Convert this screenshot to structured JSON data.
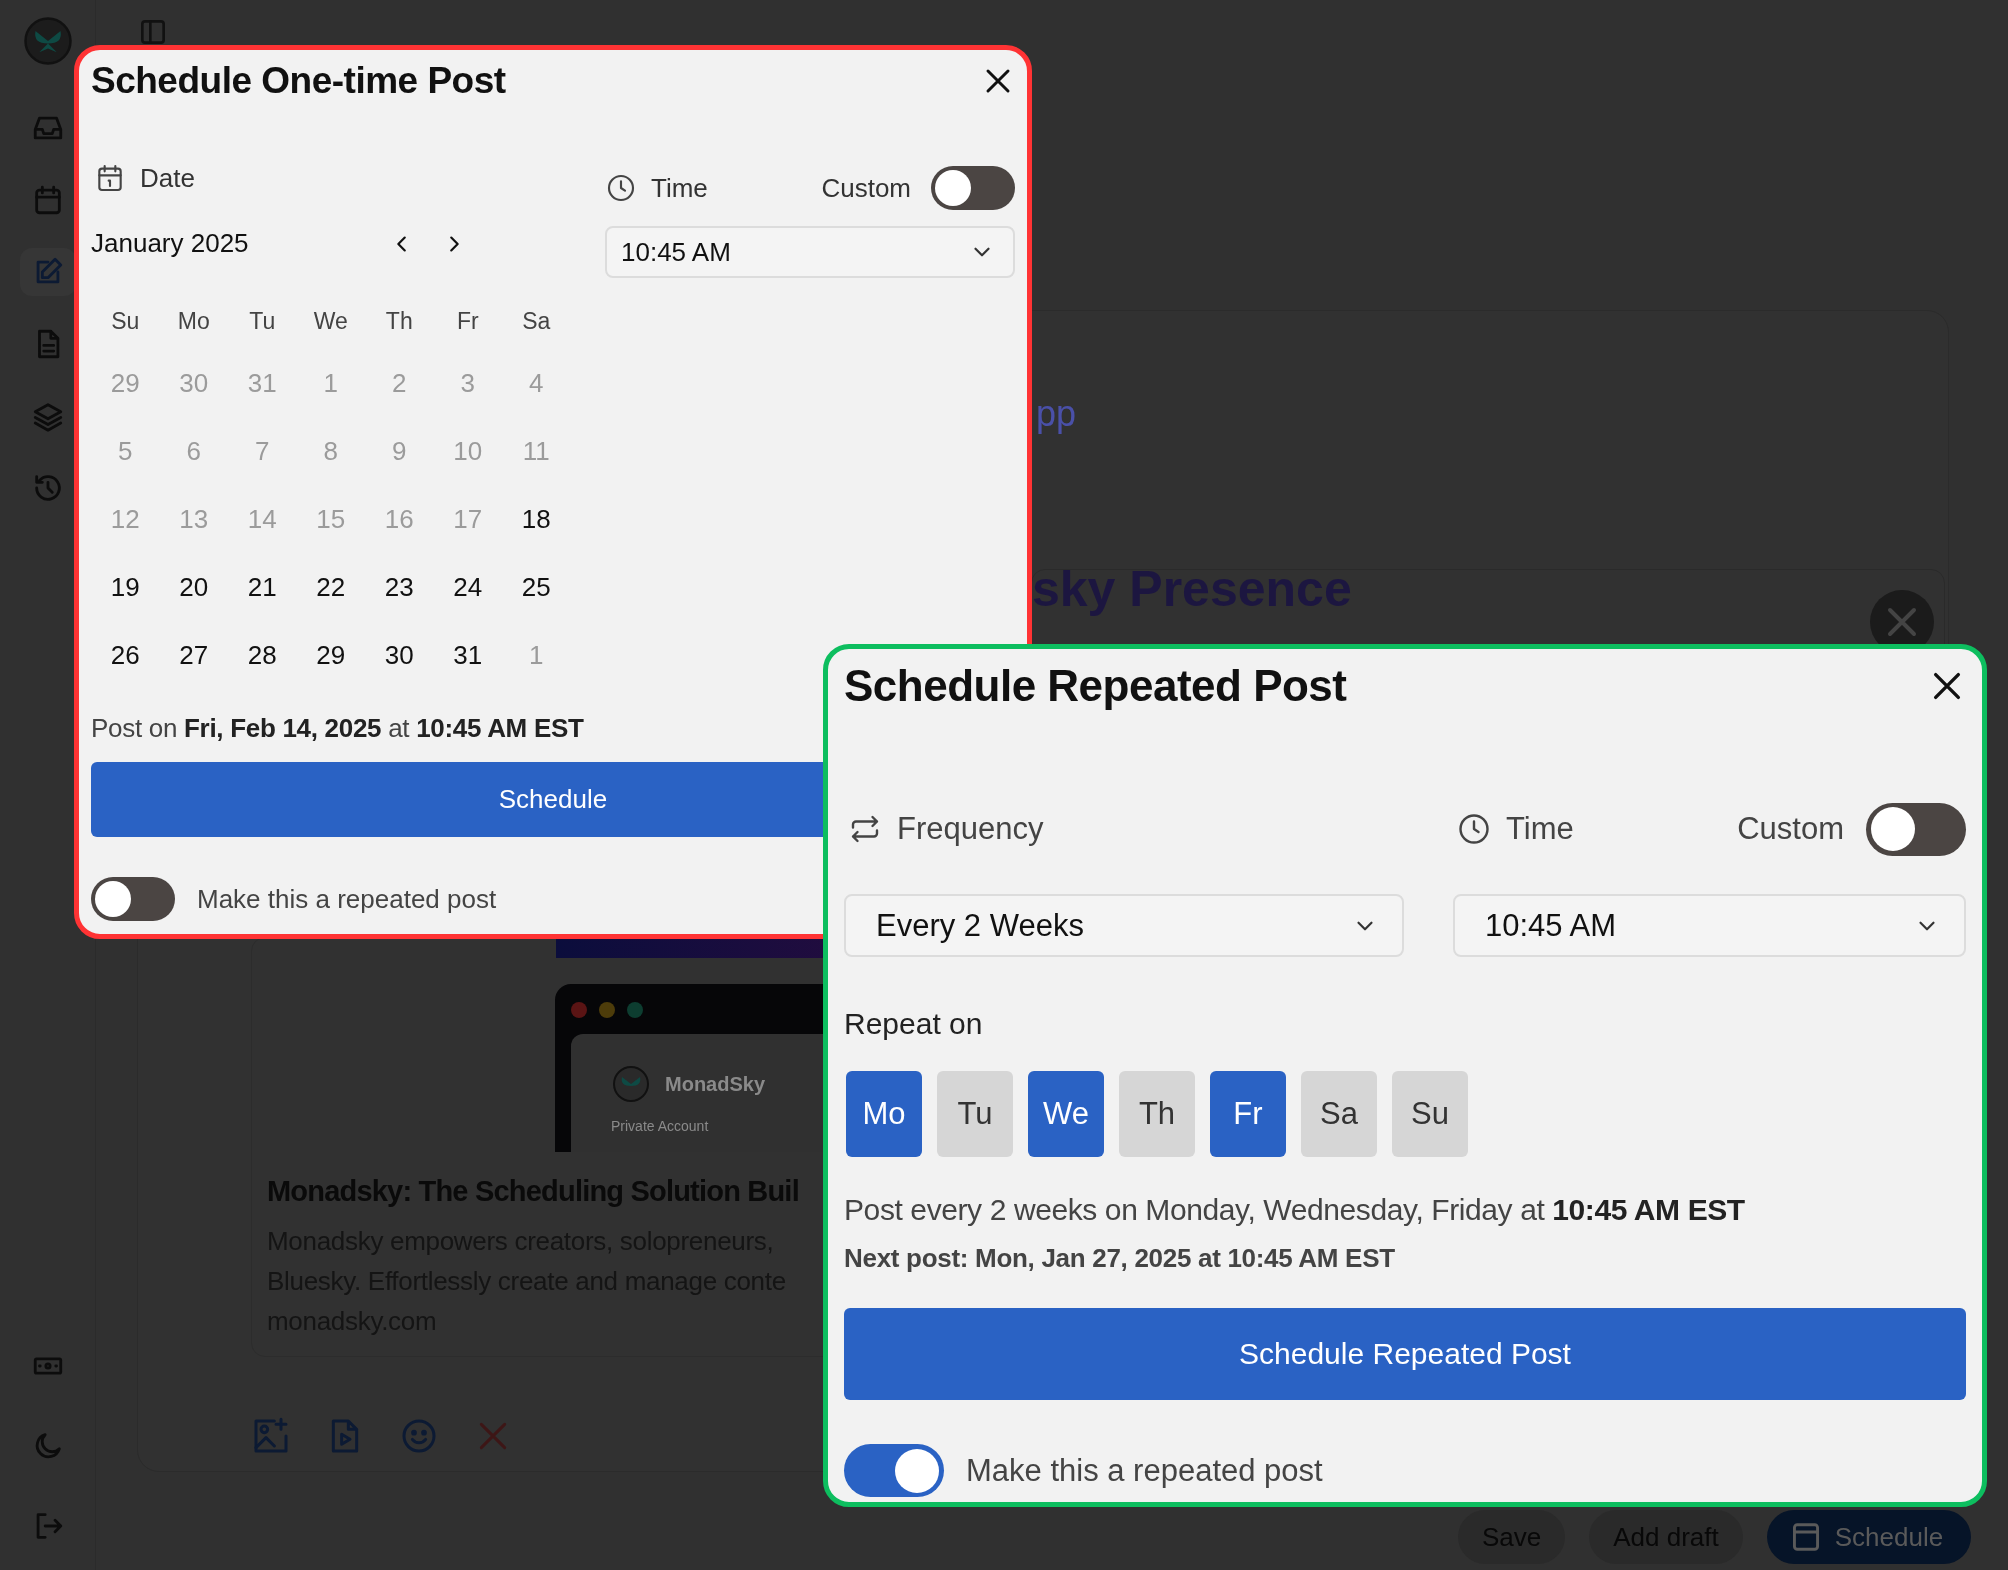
{
  "sidebar": {
    "items": [
      {
        "kind": "inbox",
        "selected": false
      },
      {
        "kind": "calendar",
        "selected": false
      },
      {
        "kind": "edit",
        "selected": true
      },
      {
        "kind": "document",
        "selected": false
      },
      {
        "kind": "layers",
        "selected": false
      },
      {
        "kind": "history",
        "selected": false
      }
    ],
    "bottom_items": [
      {
        "kind": "money"
      },
      {
        "kind": "moon"
      },
      {
        "kind": "logout"
      }
    ]
  },
  "background": {
    "heading_fragment": "pp",
    "title_fragment": "sky Presence",
    "preview": {
      "site_name": "MonadSky",
      "account": "Private Account"
    },
    "link_title": "Monadsky: The Scheduling Solution Buil",
    "description_lines": [
      "Monadsky empowers creators, solopreneurs,",
      "Bluesky. Effortlessly create and manage conte"
    ],
    "domain": "monadsky.com",
    "actions": [
      {
        "label": "Save",
        "kind": "plain"
      },
      {
        "label": "Add draft",
        "kind": "plain"
      },
      {
        "label": "Schedule",
        "kind": "primary"
      }
    ]
  },
  "one_time_dialog": {
    "title": "Schedule One-time Post",
    "date_label": "Date",
    "month": "January 2025",
    "weekdays": [
      "Su",
      "Mo",
      "Tu",
      "We",
      "Th",
      "Fr",
      "Sa"
    ],
    "days": [
      {
        "label": "29",
        "disabled": true
      },
      {
        "label": "30",
        "disabled": true
      },
      {
        "label": "31",
        "disabled": true
      },
      {
        "label": "1",
        "disabled": true
      },
      {
        "label": "2",
        "disabled": true
      },
      {
        "label": "3",
        "disabled": true
      },
      {
        "label": "4",
        "disabled": true
      },
      {
        "label": "5",
        "disabled": true
      },
      {
        "label": "6",
        "disabled": true
      },
      {
        "label": "7",
        "disabled": true
      },
      {
        "label": "8",
        "disabled": true
      },
      {
        "label": "9",
        "disabled": true
      },
      {
        "label": "10",
        "disabled": true
      },
      {
        "label": "11",
        "disabled": true
      },
      {
        "label": "12",
        "disabled": true
      },
      {
        "label": "13",
        "disabled": true
      },
      {
        "label": "14",
        "disabled": true
      },
      {
        "label": "15",
        "disabled": true
      },
      {
        "label": "16",
        "disabled": true
      },
      {
        "label": "17",
        "disabled": true
      },
      {
        "label": "18",
        "disabled": false
      },
      {
        "label": "19",
        "disabled": false
      },
      {
        "label": "20",
        "disabled": false
      },
      {
        "label": "21",
        "disabled": false
      },
      {
        "label": "22",
        "disabled": false
      },
      {
        "label": "23",
        "disabled": false
      },
      {
        "label": "24",
        "disabled": false
      },
      {
        "label": "25",
        "disabled": false
      },
      {
        "label": "26",
        "disabled": false
      },
      {
        "label": "27",
        "disabled": false
      },
      {
        "label": "28",
        "disabled": false
      },
      {
        "label": "29",
        "disabled": false
      },
      {
        "label": "30",
        "disabled": false
      },
      {
        "label": "31",
        "disabled": false
      },
      {
        "label": "1",
        "disabled": true
      }
    ],
    "time_label": "Time",
    "custom_label": "Custom",
    "custom_on": false,
    "time_value": "10:45 AM",
    "summary": "Post on **Fri, Feb 14, 2025** at **10:45 AM EST**",
    "button": "Schedule",
    "repeat_label": "Make this a repeated post",
    "repeat_on": false
  },
  "repeated_dialog": {
    "title": "Schedule Repeated Post",
    "frequency_label": "Frequency",
    "frequency_value": "Every 2 Weeks",
    "time_label": "Time",
    "custom_label": "Custom",
    "custom_on": false,
    "time_value": "10:45 AM",
    "repeat_on_label": "Repeat on",
    "days": [
      {
        "label": "Mo",
        "selected": true
      },
      {
        "label": "Tu",
        "selected": false
      },
      {
        "label": "We",
        "selected": true
      },
      {
        "label": "Th",
        "selected": false
      },
      {
        "label": "Fr",
        "selected": true
      },
      {
        "label": "Sa",
        "selected": false
      },
      {
        "label": "Su",
        "selected": false
      }
    ],
    "summary": "Post every 2 weeks on Monday, Wednesday, Friday at **10:45 AM EST**",
    "next_post": "Next post: Mon, Jan 27, 2025 at 10:45 AM EST",
    "button": "Schedule Repeated Post",
    "repeat_label": "Make this a repeated post",
    "repeat_on": true
  }
}
